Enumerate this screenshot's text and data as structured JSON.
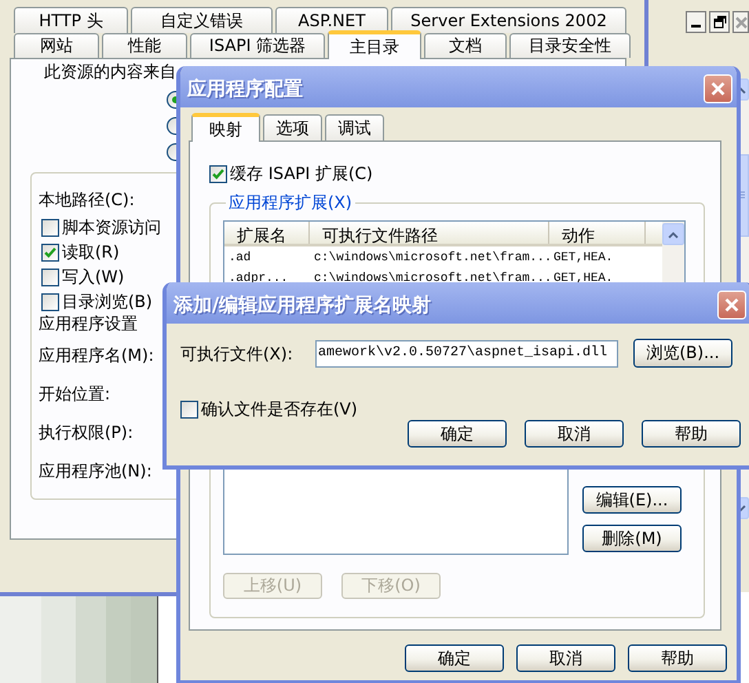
{
  "properties_window": {
    "tab_rows": [
      {
        "tabs": [
          {
            "label": "HTTP 头",
            "selected": false
          },
          {
            "label": "自定义错误",
            "selected": false
          },
          {
            "label": "ASP.NET",
            "selected": false
          },
          {
            "label": "Server Extensions 2002",
            "selected": false
          }
        ]
      },
      {
        "tabs": [
          {
            "label": "网站",
            "selected": false
          },
          {
            "label": "性能",
            "selected": false
          },
          {
            "label": "ISAPI 筛选器",
            "selected": false
          },
          {
            "label": "主目录",
            "selected": true
          },
          {
            "label": "文档",
            "selected": false
          },
          {
            "label": "目录安全性",
            "selected": false
          }
        ]
      }
    ],
    "content_source_label": "此资源的内容来自",
    "source_radios": [
      {
        "selected": true
      },
      {
        "selected": false
      },
      {
        "selected": false
      }
    ],
    "local_path_label": "本地路径(C):",
    "permissions": [
      {
        "label": "脚本资源访问",
        "checked": false
      },
      {
        "label": "读取(R)",
        "checked": true
      },
      {
        "label": "写入(W)",
        "checked": false
      },
      {
        "label": "目录浏览(B)",
        "checked": false
      }
    ],
    "app_settings_heading": "应用程序设置",
    "setting_labels": [
      "应用程序名(M):",
      "开始位置:",
      "执行权限(P):",
      "应用程序池(N):"
    ]
  },
  "app_config_dialog": {
    "title": "应用程序配置",
    "tabs": [
      {
        "label": "映射",
        "selected": true
      },
      {
        "label": "选项",
        "selected": false
      },
      {
        "label": "调试",
        "selected": false
      }
    ],
    "cache_checkbox": {
      "label": "缓存 ISAPI 扩展(C)",
      "checked": true
    },
    "group_label": "应用程序扩展(X)",
    "list": {
      "columns": [
        "扩展名",
        "可执行文件路径",
        "动作"
      ],
      "rows": [
        [
          ".ad",
          "c:\\windows\\microsoft.net\\fram...",
          "GET,HEA."
        ],
        [
          ".adpr...",
          "c:\\windows\\microsoft.net\\fram...",
          "GET,HEA."
        ]
      ]
    },
    "side_buttons": [
      {
        "label": "编辑(E)...",
        "disabled": false
      },
      {
        "label": "删除(M)",
        "disabled": false
      }
    ],
    "move_buttons": [
      {
        "label": "上移(U)",
        "disabled": true
      },
      {
        "label": "下移(O)",
        "disabled": true
      }
    ],
    "buttons": [
      "确定",
      "取消",
      "帮助"
    ]
  },
  "edit_mapping_dialog": {
    "title": "添加/编辑应用程序扩展名映射",
    "file_label": "可执行文件(X):",
    "file_value": "amework\\v2.0.50727\\aspnet_isapi.dll",
    "browse_button": "浏览(B)...",
    "verify_checkbox": {
      "label": "确认文件是否存在(V)",
      "checked": false
    },
    "buttons": [
      "确定",
      "取消",
      "帮助"
    ]
  }
}
